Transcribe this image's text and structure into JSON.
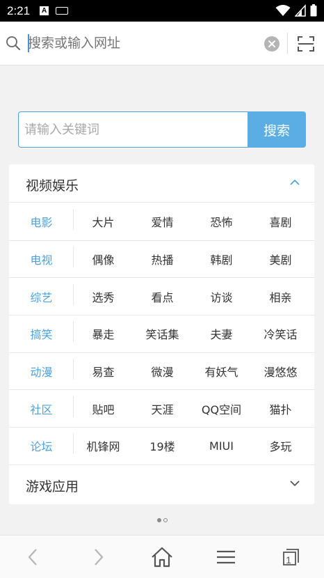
{
  "status_bar": {
    "time": "2:21",
    "a_badge": "A"
  },
  "url_bar": {
    "placeholder": "搜索或输入网址"
  },
  "keyword_search": {
    "placeholder": "请输入关键词",
    "button_label": "搜索"
  },
  "sections": {
    "video": {
      "title": "视频娱乐",
      "expanded": true
    },
    "games": {
      "title": "游戏应用",
      "expanded": false
    }
  },
  "rows": [
    {
      "category": "电影",
      "items": [
        "大片",
        "爱情",
        "恐怖",
        "喜剧"
      ]
    },
    {
      "category": "电视",
      "items": [
        "偶像",
        "热播",
        "韩剧",
        "美剧"
      ]
    },
    {
      "category": "综艺",
      "items": [
        "选秀",
        "看点",
        "访谈",
        "相亲"
      ]
    },
    {
      "category": "搞笑",
      "items": [
        "暴走",
        "笑话集",
        "夫妻",
        "冷笑话"
      ]
    },
    {
      "category": "动漫",
      "items": [
        "易查",
        "微漫",
        "有妖气",
        "漫悠悠"
      ]
    },
    {
      "category": "社区",
      "items": [
        "贴吧",
        "天涯",
        "QQ空间",
        "猫扑"
      ]
    },
    {
      "category": "论坛",
      "items": [
        "机锋网",
        "19楼",
        "MIUI",
        "多玩"
      ]
    }
  ],
  "pager": {
    "current": 1,
    "total": 2
  },
  "bottom_nav": {
    "tab_count": "1"
  },
  "colors": {
    "accent": "#4aa3df",
    "search_button": "#5aaee3",
    "status_bar": "#000000"
  }
}
